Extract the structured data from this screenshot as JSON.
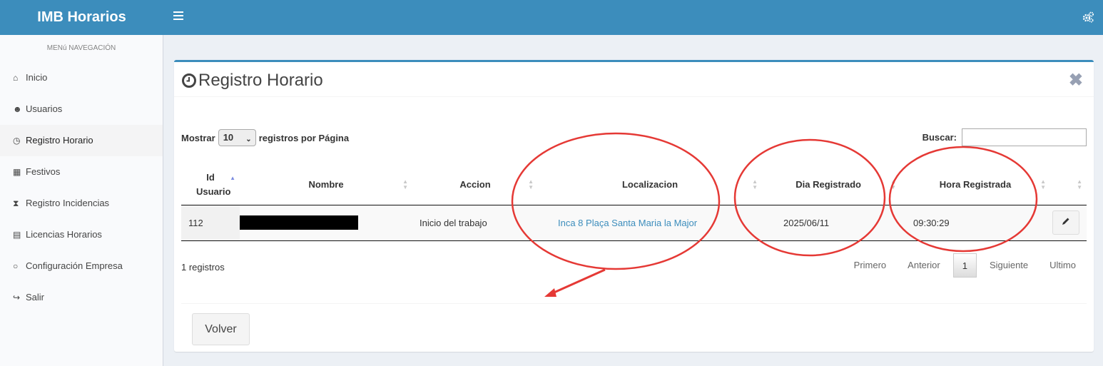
{
  "header": {
    "app_title": "IMB Horarios",
    "menu_icon": "hamburger-icon",
    "settings_icon": "gears-icon",
    "color": "#3c8dbc"
  },
  "sidebar": {
    "heading": "MENú NAVEGACIÓN",
    "items": [
      {
        "label": "Inicio",
        "icon": "home-icon",
        "glyph": "⌂"
      },
      {
        "label": "Usuarios",
        "icon": "users-icon",
        "glyph": "☻"
      },
      {
        "label": "Registro Horario",
        "icon": "clock-icon",
        "glyph": "◷",
        "active": true
      },
      {
        "label": "Festivos",
        "icon": "calendar-icon",
        "glyph": "▦"
      },
      {
        "label": "Registro Incidencias",
        "icon": "hourglass-icon",
        "glyph": "⧗"
      },
      {
        "label": "Licencias Horarios",
        "icon": "briefcase-icon",
        "glyph": "▤"
      },
      {
        "label": "Configuración Empresa",
        "icon": "circle-icon",
        "glyph": "○"
      },
      {
        "label": "Salir",
        "icon": "sign-out-icon",
        "glyph": "↪"
      }
    ]
  },
  "box": {
    "title": "Registro Horario",
    "close": "✖",
    "length_prefix": "Mostrar",
    "length_value": "10",
    "length_suffix": "registros por Página",
    "search_label": "Buscar:",
    "search_value": "",
    "columns": [
      "Id Usuario",
      "Nombre",
      "Accion",
      "Localizacion",
      "Dia Registrado",
      "Hora Registrada",
      ""
    ],
    "rows": [
      {
        "id": "112",
        "nombre": "",
        "accion": "Inicio del trabajo",
        "localizacion": "Inca 8 Plaça Santa Maria la Major",
        "dia": "2025/06/11",
        "hora": "09:30:29"
      }
    ],
    "info": "1 registros",
    "pagination": {
      "first": "Primero",
      "prev": "Anterior",
      "current": "1",
      "next": "Siguiente",
      "last": "Ultimo"
    },
    "back_button": "Volver"
  },
  "annotation_color": "#e53935"
}
